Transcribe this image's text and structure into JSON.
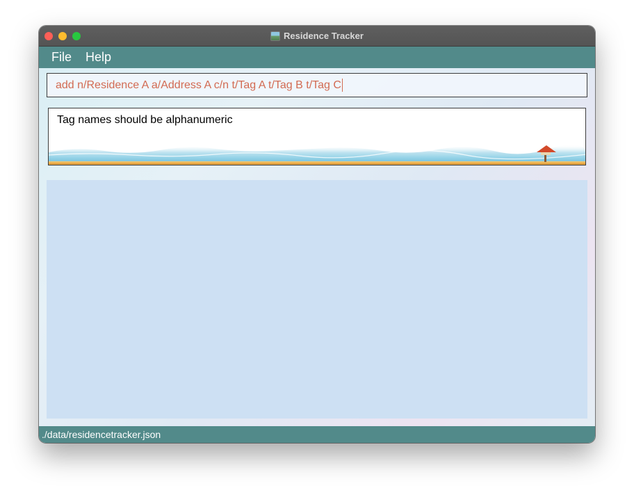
{
  "window": {
    "title": "Residence Tracker",
    "icon": "app-landscape-icon"
  },
  "menubar": {
    "items": [
      {
        "label": "File"
      },
      {
        "label": "Help"
      }
    ]
  },
  "command_box": {
    "value": "add n/Residence A a/Address A c/n t/Tag A t/Tag B t/Tag C"
  },
  "result_display": {
    "message": "Tag names should be alphanumeric"
  },
  "status_bar": {
    "save_location": "./data/residencetracker.json"
  },
  "colors": {
    "menubar_bg": "#528a8a",
    "command_text": "#d26b52",
    "list_panel_bg": "#cde0f3"
  }
}
